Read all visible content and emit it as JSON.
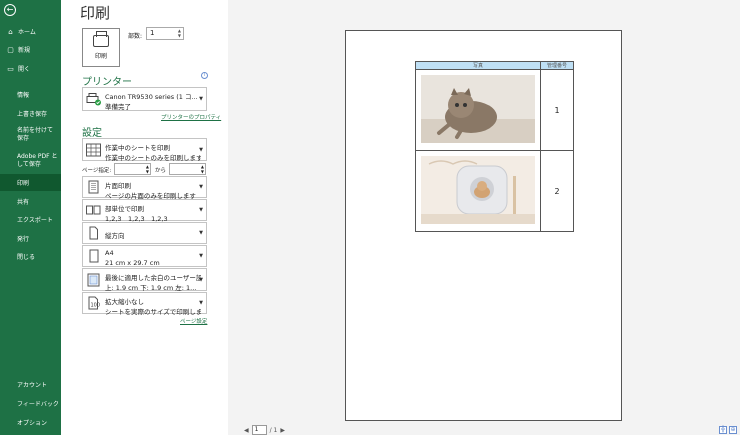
{
  "sidebar": {
    "back_icon": "back-arrow-icon",
    "items": [
      {
        "label": "ホーム",
        "icon": "⌂"
      },
      {
        "label": "新規",
        "icon": "▢"
      },
      {
        "label": "開く",
        "icon": "▭"
      },
      {
        "label": "情報"
      },
      {
        "label": "上書き保存"
      },
      {
        "label": "名前を付けて保存"
      },
      {
        "label": "Adobe PDF として保存"
      },
      {
        "label": "印刷"
      },
      {
        "label": "共有"
      },
      {
        "label": "エクスポート"
      },
      {
        "label": "発行"
      },
      {
        "label": "閉じる"
      },
      {
        "label": "アカウント"
      },
      {
        "label": "フィードバック"
      },
      {
        "label": "オプション"
      }
    ]
  },
  "title": "印刷",
  "print_button": {
    "label": "印刷"
  },
  "copies": {
    "label": "部数:",
    "value": "1"
  },
  "printer": {
    "heading": "プリンター",
    "name": "Canon TR9530 series (1 コ...",
    "status": "準備完了",
    "properties_link": "プリンターのプロパティ"
  },
  "settings": {
    "heading": "設定",
    "scope": {
      "l1": "作業中のシートを印刷",
      "l2": "作業中のシートのみを印刷します"
    },
    "pages": {
      "label": "ページ指定:",
      "to": "から"
    },
    "sides": {
      "l1": "片面印刷",
      "l2": "ページの片面のみを印刷します"
    },
    "collate": {
      "l1": "部単位で印刷",
      "l2": "1,2,3　1,2,3　1,2,3"
    },
    "orientation": {
      "l1": "縦方向"
    },
    "paper": {
      "l1": "A4",
      "l2": "21 cm x 29.7 cm"
    },
    "margins": {
      "l1": "最後に適用した余白のユーザー設定",
      "l2": "上: 1.9 cm 下: 1.9 cm 左: 1..."
    },
    "scaling": {
      "l1": "拡大縮小なし",
      "l2": "シートを実際のサイズで印刷します"
    },
    "page_setup_link": "ページ設定"
  },
  "preview": {
    "headers": [
      "写真",
      "管理番号"
    ],
    "rows": [
      {
        "photo": "cat-on-rug-photo",
        "number": "1"
      },
      {
        "photo": "cat-in-box-photo",
        "number": "2"
      }
    ]
  },
  "pager": {
    "prev": "◀",
    "current": "1",
    "total": "/ 1",
    "next": "▶"
  },
  "colors": {
    "sidebar": "#1e7145",
    "active": "#10582f",
    "accent": "#1e7145"
  }
}
